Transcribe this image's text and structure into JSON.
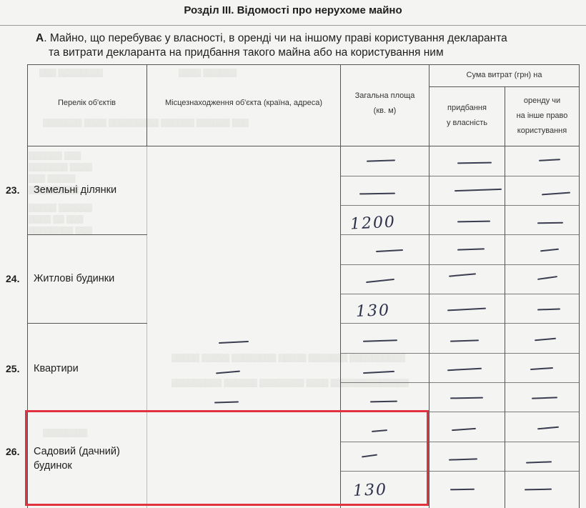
{
  "header": {
    "section_title": "Розділ ІІІ. Відомості про нерухоме майно",
    "subtitle_letter": "А",
    "subtitle_line1": ". Майно, що перебуває у власності, в оренді чи на іншому праві користування декларанта",
    "subtitle_line2": "та витрати декларанта на придбання такого майна або на користування ним"
  },
  "table": {
    "columns": {
      "objects": "Перелік об'єктів",
      "location": "Місцезнаходження об'єкта (країна, адреса)",
      "area_line1": "Загальна площа",
      "area_line2": "(кв. м)",
      "expenses": "Сума витрат (грн) на",
      "purchase_line1": "придбання",
      "purchase_line2": "у власність",
      "rent_line1": "оренду чи",
      "rent_line2": "на інше право",
      "rent_line3": "користування"
    },
    "rows": [
      {
        "number": "23.",
        "name": "Земельні ділянки",
        "area_value": "1200"
      },
      {
        "number": "24.",
        "name": "Житлові будинки",
        "area_value": "130"
      },
      {
        "number": "25.",
        "name": "Квартири",
        "area_value": ""
      },
      {
        "number": "26.",
        "name_line1": "Садовий (дачний)",
        "name_line2": "будинок",
        "area_value": "130"
      }
    ]
  },
  "colors": {
    "highlight": "#e0333f",
    "ink": "#2b2f4a",
    "paper": "#f4f4f2"
  }
}
